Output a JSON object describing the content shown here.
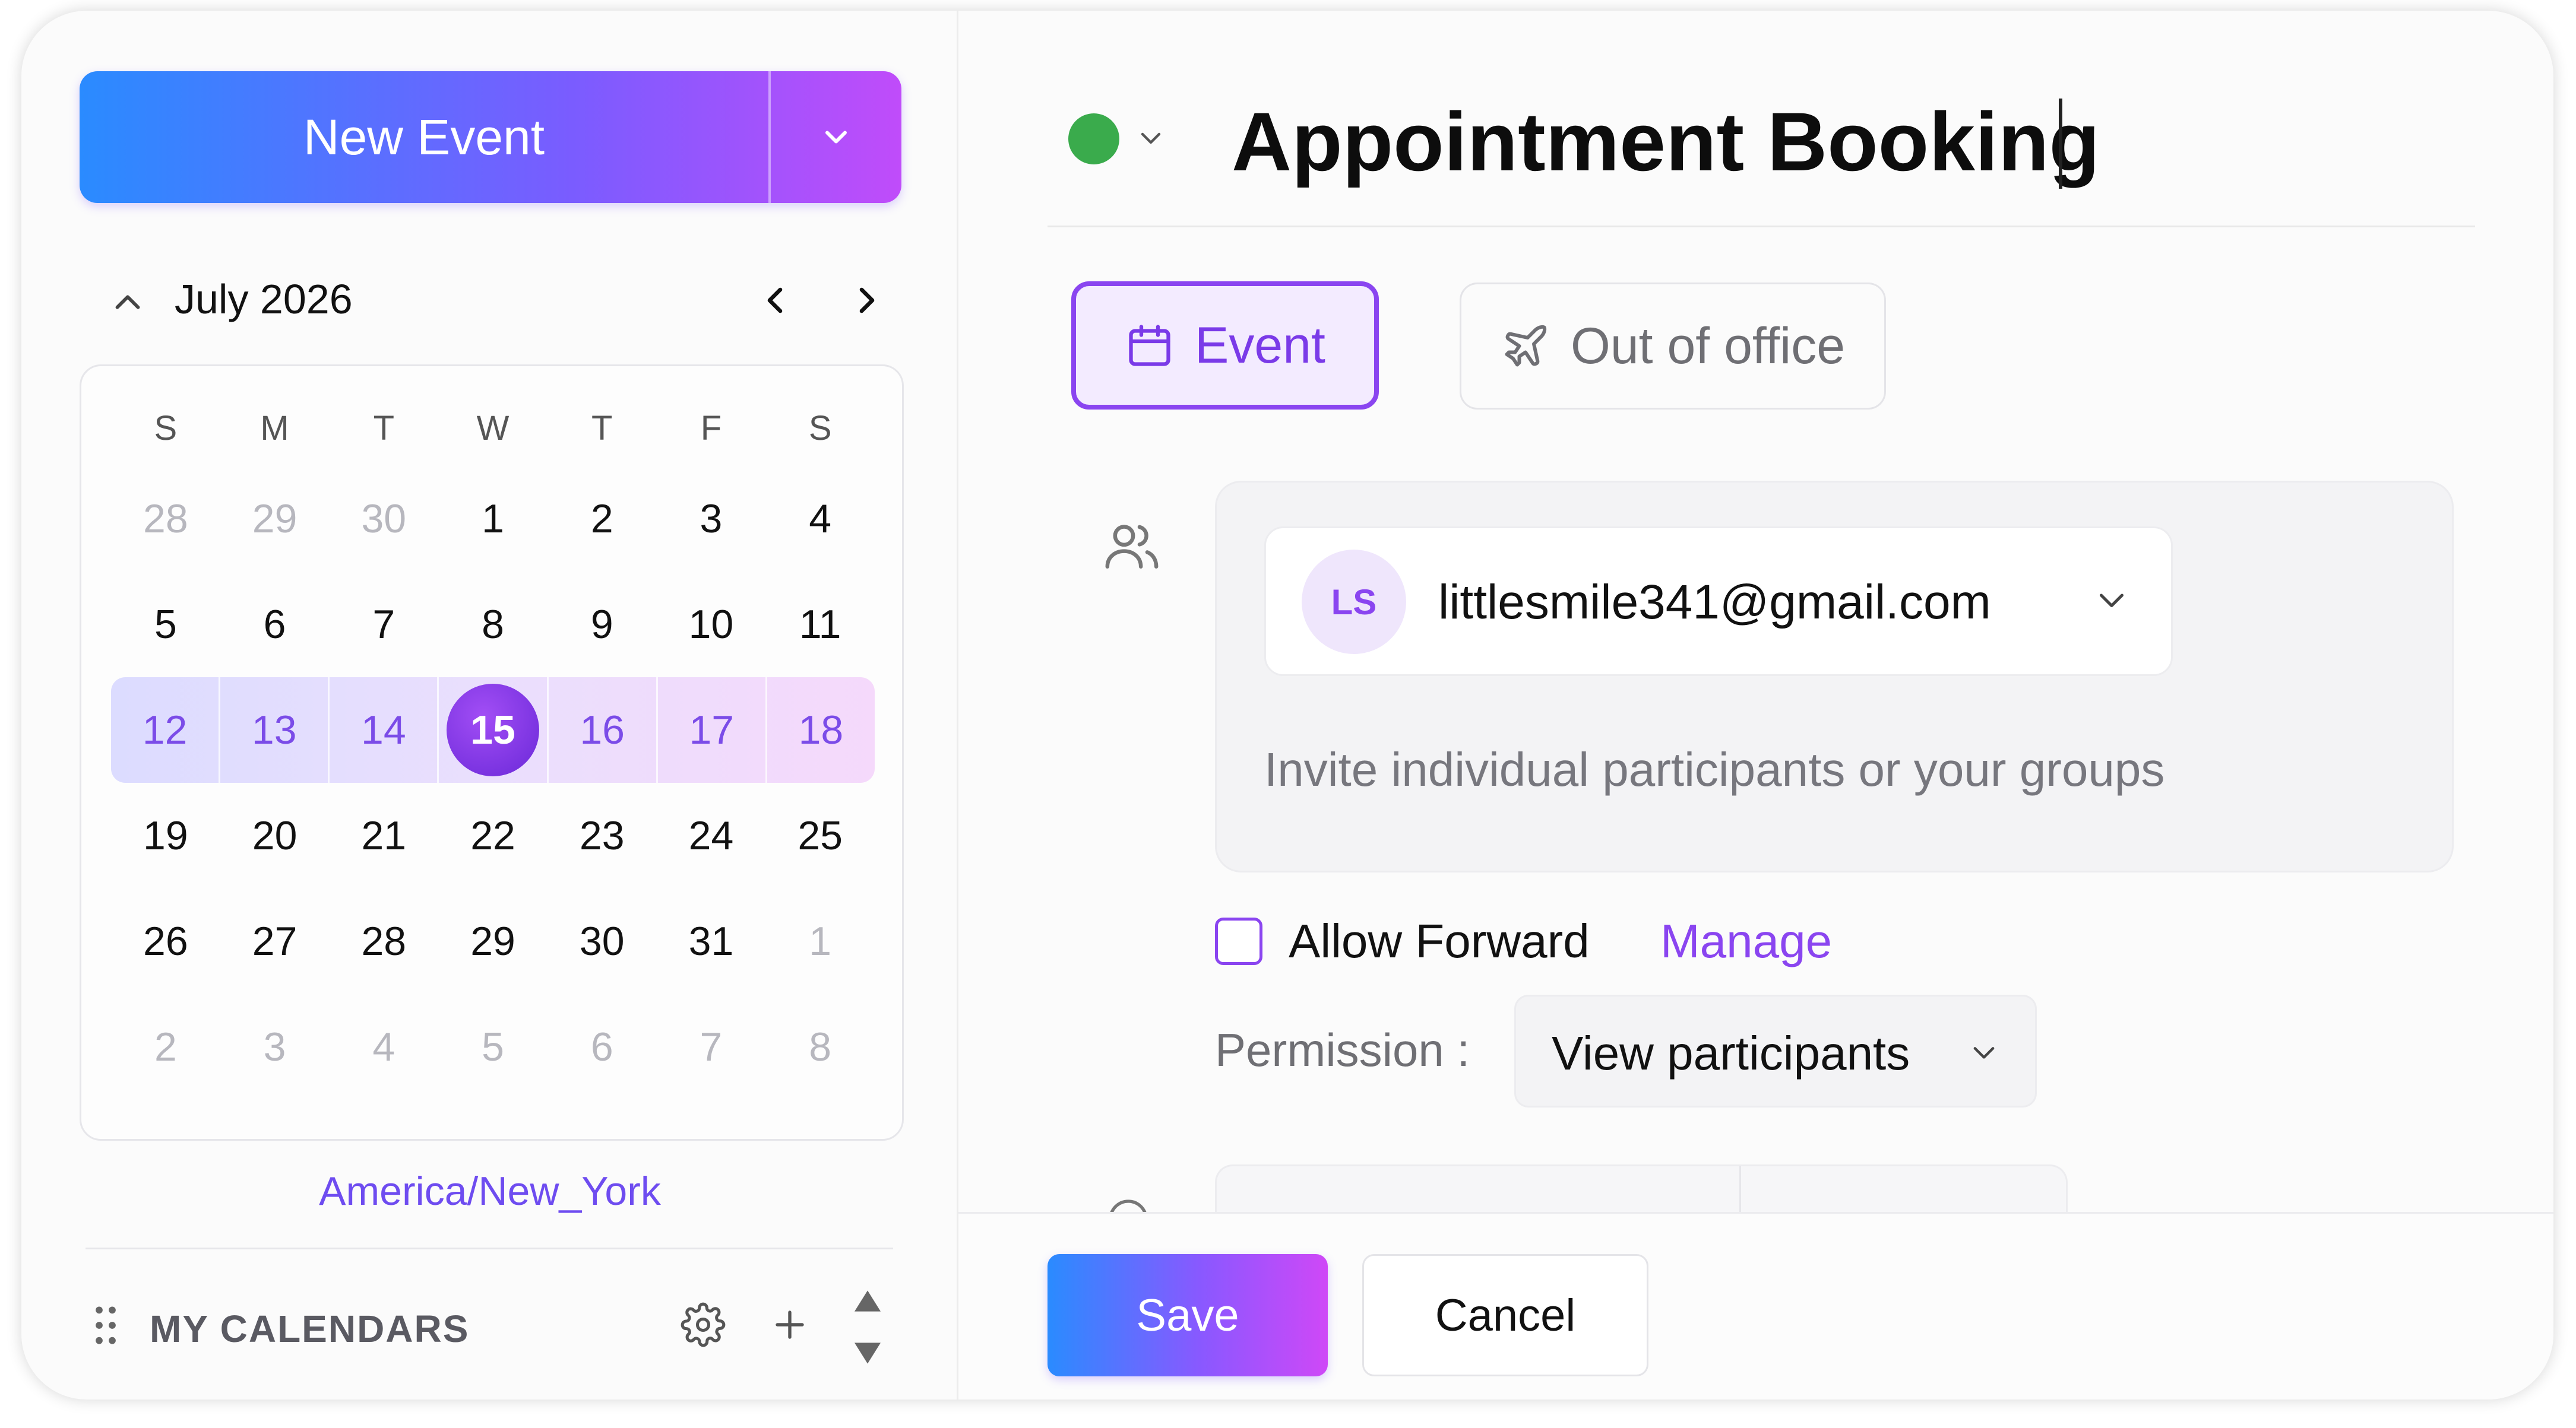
{
  "sidebar": {
    "new_event_label": "New Event",
    "month_label": "July 2026",
    "weekdays": [
      "S",
      "M",
      "T",
      "W",
      "T",
      "F",
      "S"
    ],
    "weeks": [
      [
        {
          "d": "28",
          "m": true
        },
        {
          "d": "29",
          "m": true
        },
        {
          "d": "30",
          "m": true
        },
        {
          "d": "1"
        },
        {
          "d": "2"
        },
        {
          "d": "3"
        },
        {
          "d": "4"
        }
      ],
      [
        {
          "d": "5"
        },
        {
          "d": "6"
        },
        {
          "d": "7"
        },
        {
          "d": "8"
        },
        {
          "d": "9"
        },
        {
          "d": "10"
        },
        {
          "d": "11"
        }
      ],
      [
        {
          "d": "12"
        },
        {
          "d": "13"
        },
        {
          "d": "14"
        },
        {
          "d": "15",
          "sel": true
        },
        {
          "d": "16"
        },
        {
          "d": "17"
        },
        {
          "d": "18"
        }
      ],
      [
        {
          "d": "19"
        },
        {
          "d": "20"
        },
        {
          "d": "21"
        },
        {
          "d": "22"
        },
        {
          "d": "23"
        },
        {
          "d": "24"
        },
        {
          "d": "25"
        }
      ],
      [
        {
          "d": "26"
        },
        {
          "d": "27"
        },
        {
          "d": "28"
        },
        {
          "d": "29"
        },
        {
          "d": "30"
        },
        {
          "d": "31"
        },
        {
          "d": "1",
          "m": true
        }
      ],
      [
        {
          "d": "2",
          "m": true
        },
        {
          "d": "3",
          "m": true
        },
        {
          "d": "4",
          "m": true
        },
        {
          "d": "5",
          "m": true
        },
        {
          "d": "6",
          "m": true
        },
        {
          "d": "7",
          "m": true
        },
        {
          "d": "8",
          "m": true
        }
      ]
    ],
    "highlighted_week_index": 2,
    "timezone": "America/New_York",
    "my_calendars_label": "MY CALENDARS"
  },
  "editor": {
    "status_color": "#3aab4c",
    "title": "Appointment Booking",
    "types": {
      "event_label": "Event",
      "out_of_office_label": "Out of office",
      "selected": "Event"
    },
    "participants": {
      "user": {
        "initials": "LS",
        "email": "littlesmile341@gmail.com"
      },
      "invite_placeholder": "Invite individual participants or your groups"
    },
    "allow_forward": {
      "label": "Allow Forward",
      "checked": false
    },
    "manage_label": "Manage",
    "permission": {
      "label": "Permission :",
      "value": "View participants"
    },
    "save_label": "Save",
    "cancel_label": "Cancel"
  },
  "colors": {
    "accent": "#8a45f0",
    "gradient_start": "#2a8bff",
    "gradient_end": "#c04cfa",
    "status_green": "#3aab4c"
  }
}
